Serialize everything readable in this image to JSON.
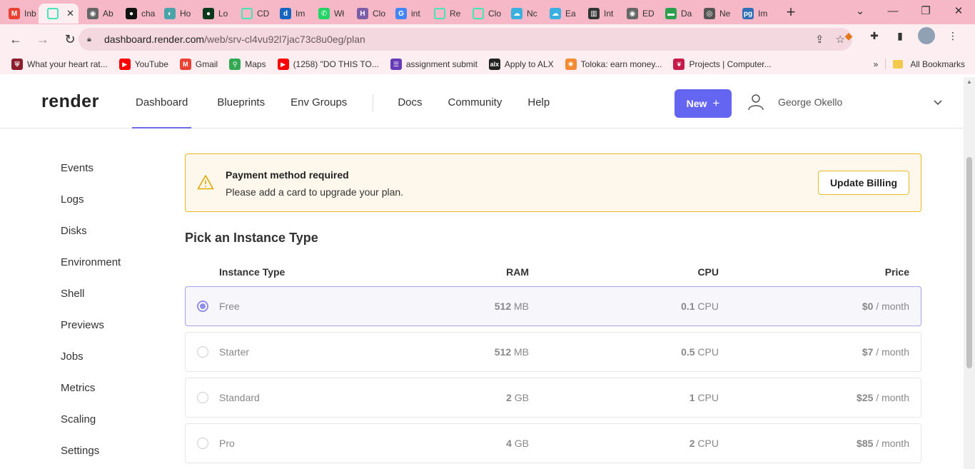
{
  "browser": {
    "tabs": [
      {
        "label": "Inb",
        "icon": "gmail-icon",
        "color": "#ea4335",
        "glyph": "M"
      },
      {
        "label": "",
        "icon": "render-icon",
        "color": "#46e3b7",
        "glyph": "",
        "active": true
      },
      {
        "label": "Ab",
        "icon": "globe-icon",
        "color": "#666",
        "glyph": "◉"
      },
      {
        "label": "cha",
        "icon": "github-icon",
        "color": "#111",
        "glyph": "●"
      },
      {
        "label": "Ho",
        "icon": "eye-icon",
        "color": "#4aa3a8",
        "glyph": "◐"
      },
      {
        "label": "Lo",
        "icon": "mongodb-icon",
        "color": "#0b3a1a",
        "glyph": "●"
      },
      {
        "label": "CD",
        "icon": "render-icon",
        "color": "#46e3b7",
        "glyph": ""
      },
      {
        "label": "Im",
        "icon": "d-icon",
        "color": "#1565c0",
        "glyph": "d"
      },
      {
        "label": "Wł",
        "icon": "whatsapp-icon",
        "color": "#25d366",
        "glyph": "✆"
      },
      {
        "label": "Clo",
        "icon": "h-icon",
        "color": "#7b5ea7",
        "glyph": "H"
      },
      {
        "label": "int",
        "icon": "google-icon",
        "color": "#4285f4",
        "glyph": "G"
      },
      {
        "label": "Re",
        "icon": "render-icon",
        "color": "#46e3b7",
        "glyph": ""
      },
      {
        "label": "Clo",
        "icon": "render-icon",
        "color": "#46e3b7",
        "glyph": ""
      },
      {
        "label": "Nc",
        "icon": "cloud-icon",
        "color": "#3ab0e0",
        "glyph": "☁"
      },
      {
        "label": "Ea",
        "icon": "cloud-icon",
        "color": "#3ab0e0",
        "glyph": "☁"
      },
      {
        "label": "Int",
        "icon": "book-icon",
        "color": "#333",
        "glyph": "▥"
      },
      {
        "label": "ED",
        "icon": "globe-icon",
        "color": "#666",
        "glyph": "◉"
      },
      {
        "label": "Da",
        "icon": "dashboard-icon",
        "color": "#2e9e4f",
        "glyph": "▬"
      },
      {
        "label": "Ne",
        "icon": "chrome-icon",
        "color": "#555",
        "glyph": "◎"
      },
      {
        "label": "Im",
        "icon": "pg-icon",
        "color": "#2f6fb5",
        "glyph": "pg"
      }
    ],
    "url_host": "dashboard.render.com",
    "url_path": "/web/srv-cl4vu92l7jac73c8u0eg/plan",
    "bookmarks": [
      {
        "label": "What your heart rat...",
        "icon": "shield-icon",
        "color": "#8b1d2c",
        "glyph": "⛨"
      },
      {
        "label": "YouTube",
        "icon": "youtube-icon",
        "color": "#ff0000",
        "glyph": "▶"
      },
      {
        "label": "Gmail",
        "icon": "gmail-icon",
        "color": "#ea4335",
        "glyph": "M"
      },
      {
        "label": "Maps",
        "icon": "maps-icon",
        "color": "#34a853",
        "glyph": "⚲"
      },
      {
        "label": "(1258) \"DO THIS TO...",
        "icon": "youtube-icon",
        "color": "#ff0000",
        "glyph": "▶"
      },
      {
        "label": "assignment submit",
        "icon": "form-icon",
        "color": "#673ab7",
        "glyph": "☰"
      },
      {
        "label": "Apply to ALX",
        "icon": "alx-icon",
        "color": "#222",
        "glyph": "alx"
      },
      {
        "label": "Toloka: earn money...",
        "icon": "toloka-icon",
        "color": "#f28b33",
        "glyph": "✺"
      },
      {
        "label": "Projects | Computer...",
        "icon": "raspberry-icon",
        "color": "#c51a4a",
        "glyph": "❦"
      }
    ],
    "all_bookmarks": "All Bookmarks"
  },
  "header": {
    "logo": "render",
    "nav": [
      "Dashboard",
      "Blueprints",
      "Env Groups"
    ],
    "nav2": [
      "Docs",
      "Community",
      "Help"
    ],
    "new_button": "New",
    "user_name": "George Okello"
  },
  "sidebar": {
    "items": [
      "Events",
      "Logs",
      "Disks",
      "Environment",
      "Shell",
      "Previews",
      "Jobs",
      "Metrics",
      "Scaling",
      "Settings"
    ]
  },
  "banner": {
    "title": "Payment method required",
    "message": "Please add a card to upgrade your plan.",
    "button": "Update Billing"
  },
  "instance": {
    "heading": "Pick an Instance Type",
    "columns": {
      "type": "Instance Type",
      "ram": "RAM",
      "cpu": "CPU",
      "price": "Price"
    },
    "rows": [
      {
        "name": "Free",
        "ram_val": "512",
        "ram_unit": " MB",
        "cpu_val": "0.1",
        "cpu_unit": " CPU",
        "price_val": "$0",
        "price_unit": " / month",
        "selected": true
      },
      {
        "name": "Starter",
        "ram_val": "512",
        "ram_unit": " MB",
        "cpu_val": "0.5",
        "cpu_unit": " CPU",
        "price_val": "$7",
        "price_unit": " / month",
        "selected": false
      },
      {
        "name": "Standard",
        "ram_val": "2",
        "ram_unit": " GB",
        "cpu_val": "1",
        "cpu_unit": " CPU",
        "price_val": "$25",
        "price_unit": " / month",
        "selected": false
      },
      {
        "name": "Pro",
        "ram_val": "4",
        "ram_unit": " GB",
        "cpu_val": "2",
        "cpu_unit": " CPU",
        "price_val": "$85",
        "price_unit": " / month",
        "selected": false
      }
    ]
  },
  "colors": {
    "accent": "#6466f1",
    "warning": "#e8b929",
    "chrome": "#f6b8c6"
  }
}
